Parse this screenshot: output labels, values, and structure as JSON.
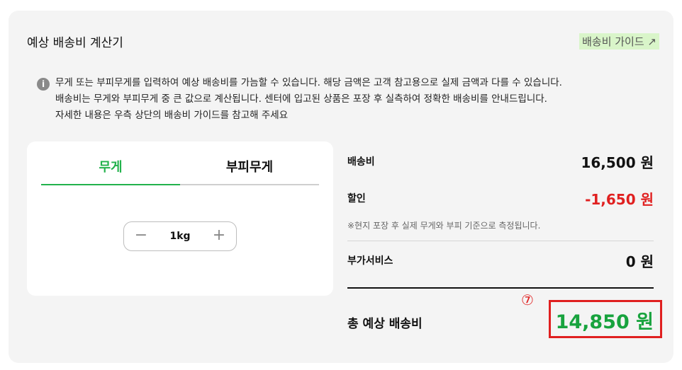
{
  "header": {
    "title": "예상 배송비 계산기",
    "guide_link": "배송비 가이드 ↗"
  },
  "notice": {
    "icon": "info-icon",
    "icon_glyph": "i",
    "lines": [
      "무게 또는 부피무게를 입력하여 예상 배송비를 가늠할 수 있습니다. 해당 금액은 고객 참고용으로 실제 금액과 다를 수 있습니다.",
      "배송비는 무게와 부피무게 중 큰 값으로 계산됩니다. 센터에 입고된 상품은 포장 후 실측하여 정확한 배송비를 안내드립니다.",
      "자세한 내용은 우측 상단의 배송비 가이드를 참고해 주세요"
    ]
  },
  "tabs": {
    "weight": "무게",
    "volume_weight": "부피무게",
    "active": "weight"
  },
  "stepper": {
    "minus": "−",
    "value": "1kg",
    "plus": "+"
  },
  "summary": {
    "shipping_label": "배송비",
    "shipping_amount": "16,500 원",
    "discount_label": "할인",
    "discount_amount": "-1,650 원",
    "note": "※현지 포장 후 실제 무게와 부피 기준으로 측정됩니다.",
    "addon_label": "부가서비스",
    "addon_amount": "0 원",
    "total_label": "총 예상 배송비",
    "total_amount": "14,850 원",
    "marker": "⑦"
  },
  "colors": {
    "accent_green": "#22b24c",
    "total_green": "#18a33e",
    "discount_red": "#e02020",
    "highlight_box": "#e02020",
    "panel_bg": "#f4f4f4"
  }
}
